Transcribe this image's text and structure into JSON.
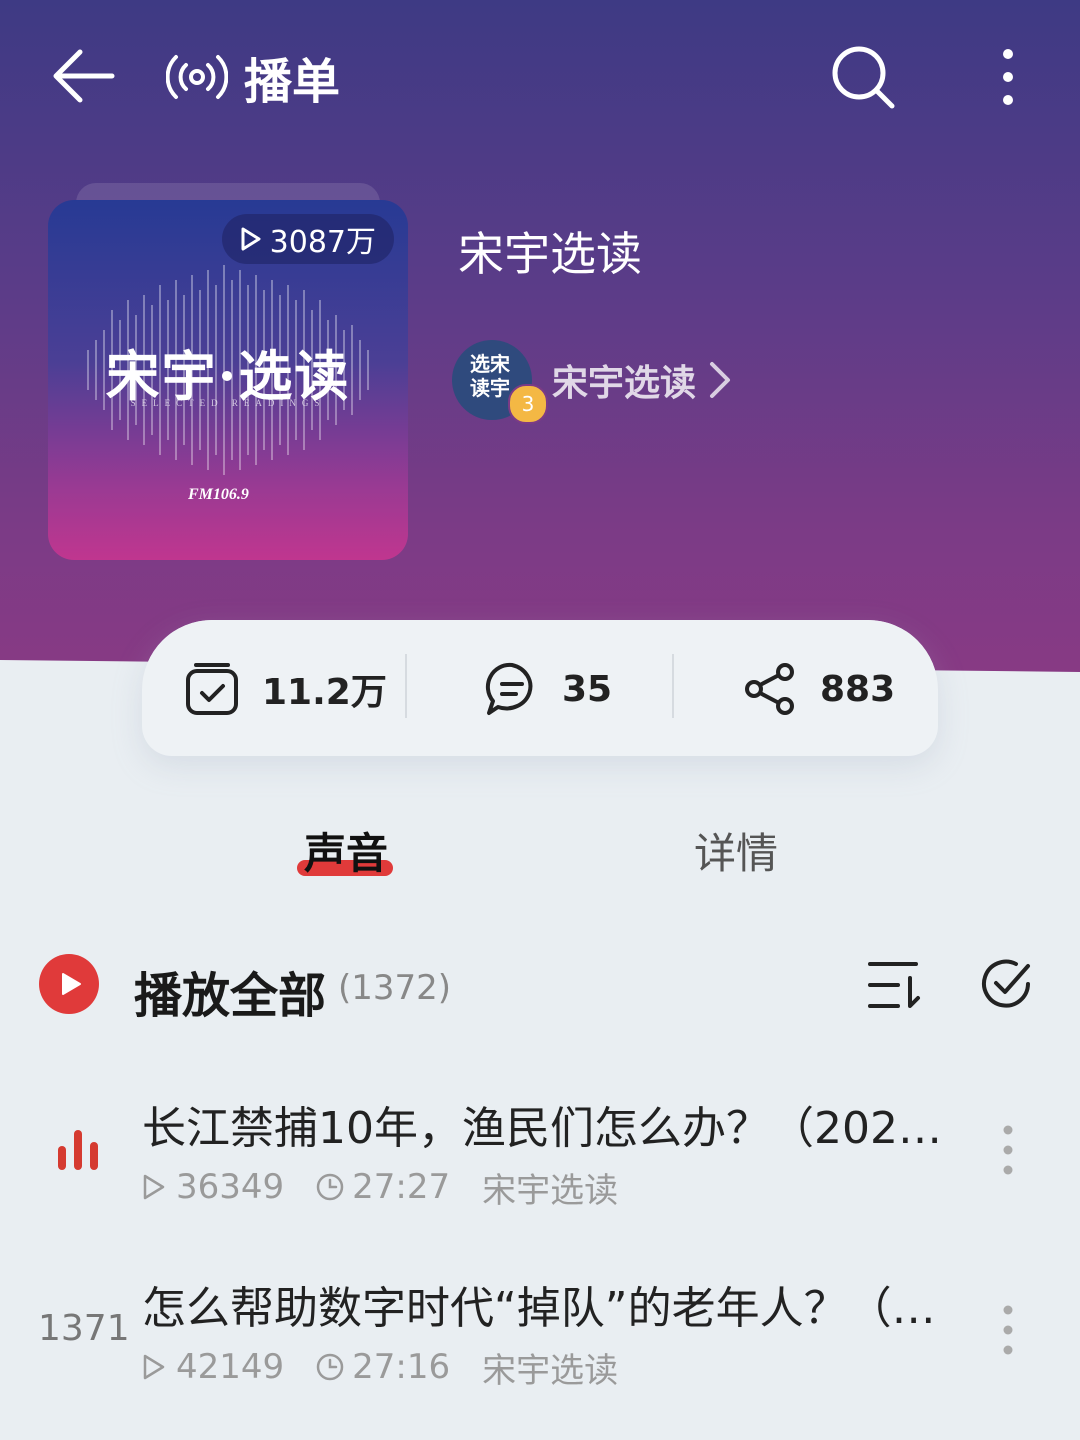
{
  "topbar": {
    "title": "播单"
  },
  "album": {
    "cover_title": "宋宇·选读",
    "cover_subtitle": "SELECTED READINGS",
    "cover_station": "FM106.9",
    "play_count": "3087万",
    "title": "宋宇选读",
    "author_name": "宋宇选读",
    "author_avatar_text": "选宋读宇",
    "author_level": "3"
  },
  "stats": {
    "subscribe_count": "11.2万",
    "comment_count": "35",
    "share_count": "883"
  },
  "tabs": [
    {
      "label": "声音",
      "active": true
    },
    {
      "label": "详情",
      "active": false
    }
  ],
  "play_all": {
    "label": "播放全部",
    "count": "(1372)"
  },
  "tracks": [
    {
      "index": "",
      "playing": true,
      "title": "长江禁捕10年，渔民们怎么办？（2021...",
      "plays": "36349",
      "duration": "27:27",
      "author": "宋宇选读"
    },
    {
      "index": "1371",
      "playing": false,
      "title": "怎么帮助数字时代“掉队”的老年人？（2...",
      "plays": "42149",
      "duration": "27:16",
      "author": "宋宇选读"
    }
  ],
  "colors": {
    "accent": "#e03a3a",
    "header_top": "#3e3a84",
    "header_bottom": "#8a3a84"
  }
}
